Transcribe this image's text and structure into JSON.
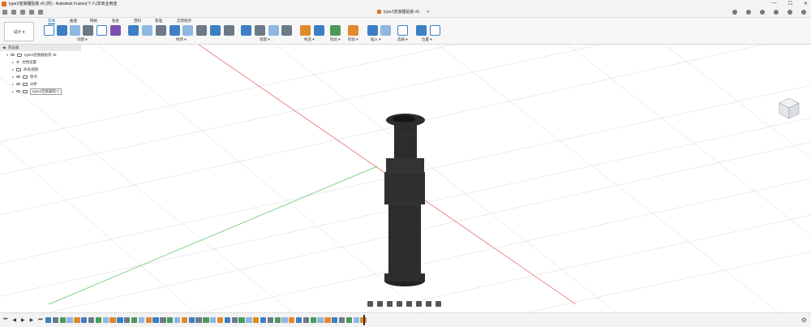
{
  "window": {
    "title": "type2连接器贴装 v5 (所) - Autodesk Fusion(个人)非商业用途",
    "minimize": "—",
    "maximize": "☐",
    "close": "✕"
  },
  "doc_tab": {
    "label": "type2连接器贴装 v5",
    "close": "✕"
  },
  "workspace": {
    "label": "设计 ▾"
  },
  "ribbon_tabs": [
    "实体",
    "曲面",
    "网格",
    "钣金",
    "塑料",
    "管理",
    "实用程序"
  ],
  "groups": [
    {
      "label": "创建 ▾"
    },
    {
      "label": "修改 ▾"
    },
    {
      "label": "装配 ▾"
    },
    {
      "label": "构造 ▾"
    },
    {
      "label": "检验 ▾"
    },
    {
      "label": "插入 ▾"
    },
    {
      "label": "选择 ▾"
    },
    {
      "label": "位置 ▾"
    }
  ],
  "browser": {
    "header": "浏览器",
    "root": "type2连接器贴装 v5",
    "items": [
      "文档设置",
      "命名视图",
      "原点",
      "分析",
      "type2连接器装:1"
    ]
  },
  "timeline": {
    "controls": [
      "⏮",
      "◀",
      "▶",
      "▶",
      "⏭"
    ],
    "gear": "⚙"
  },
  "colors": {
    "accent": "#0a5fb4",
    "part": "#2b2d2c",
    "x_axis": "#e05050",
    "y_axis": "#49b849",
    "grid": "#cfd3d6"
  }
}
